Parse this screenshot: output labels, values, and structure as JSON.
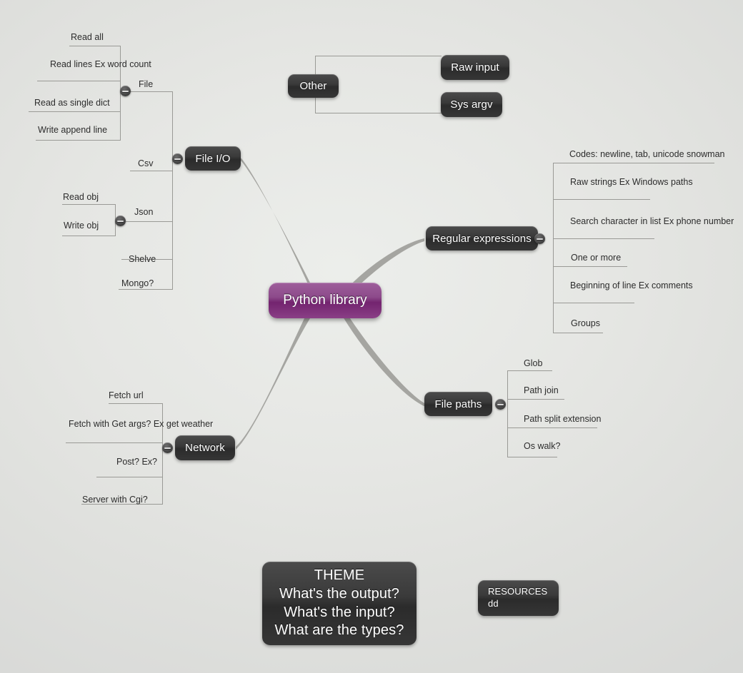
{
  "document": {
    "title": "Python library",
    "type": "mindmap"
  },
  "theme": {
    "background": "#e6e7e4",
    "node_fill": "#3a3a3a",
    "central_fill": "#8d4b8b",
    "leaf_text": "#2c2c2c",
    "connector": "#9a9a96"
  },
  "central": {
    "label": "Python library"
  },
  "branches": {
    "file_io": {
      "label": "File I/O",
      "toggle": "collapse-toggle",
      "children": [
        {
          "label": "File",
          "toggle": "collapse-toggle",
          "children": [
            {
              "lines": [
                "Read all"
              ]
            },
            {
              "lines": [
                "Read lines",
                "Ex word count"
              ]
            },
            {
              "lines": [
                "Read as single dict"
              ]
            },
            {
              "lines": [
                "Write append line"
              ]
            }
          ]
        },
        {
          "label": "Csv",
          "children": []
        },
        {
          "label": "Json",
          "toggle": "collapse-toggle",
          "children": [
            {
              "lines": [
                "Read obj"
              ]
            },
            {
              "lines": [
                "Write obj"
              ]
            }
          ]
        },
        {
          "label": "Shelve",
          "children": []
        },
        {
          "label": "Mongo?",
          "children": []
        }
      ]
    },
    "other": {
      "label": "Other",
      "children": [
        {
          "label": "Raw input"
        },
        {
          "label": "Sys argv"
        }
      ]
    },
    "regular_expressions": {
      "label": "Regular expressions",
      "toggle": "collapse-toggle",
      "children": [
        {
          "lines": [
            "Codes: newline, tab, unicode snowman"
          ]
        },
        {
          "lines": [
            "Raw strings",
            "Ex Windows paths"
          ]
        },
        {
          "lines": [
            "Search character in list",
            "Ex phone number"
          ]
        },
        {
          "lines": [
            "One or more"
          ]
        },
        {
          "lines": [
            "Beginning of line",
            "Ex comments"
          ]
        },
        {
          "lines": [
            "Groups"
          ]
        }
      ]
    },
    "file_paths": {
      "label": "File paths",
      "toggle": "collapse-toggle",
      "children": [
        {
          "lines": [
            "Glob"
          ]
        },
        {
          "lines": [
            "Path join"
          ]
        },
        {
          "lines": [
            "Path split extension"
          ]
        },
        {
          "lines": [
            "Os walk?"
          ]
        }
      ]
    },
    "network": {
      "label": "Network",
      "toggle": "collapse-toggle",
      "children": [
        {
          "lines": [
            "Fetch url"
          ]
        },
        {
          "lines": [
            "Fetch with Get args?",
            "Ex get weather"
          ]
        },
        {
          "lines": [
            "Post?",
            "Ex?"
          ]
        },
        {
          "lines": [
            "Server with Cgi?"
          ]
        }
      ]
    }
  },
  "floating_notes": {
    "theme_note": {
      "lines": [
        "THEME",
        "What's the output?",
        "What's the input?",
        "What are the types?"
      ]
    },
    "resources_note": {
      "lines": [
        "RESOURCES",
        "dd"
      ]
    }
  }
}
